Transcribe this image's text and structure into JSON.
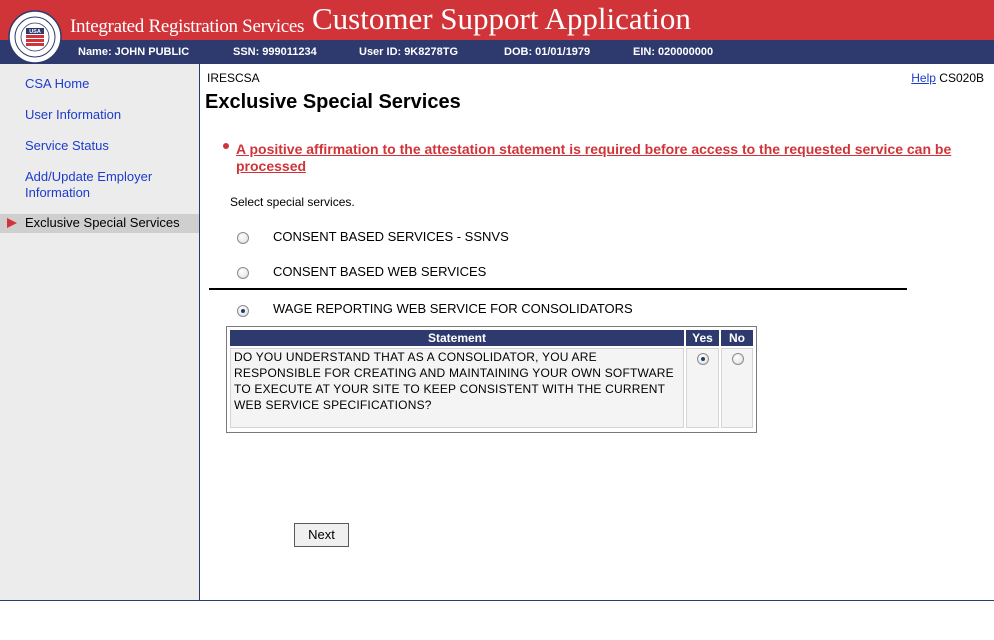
{
  "header": {
    "subtitle": "Integrated Registration Services",
    "title": "Customer Support Application",
    "seal_text": "USA"
  },
  "user_info": {
    "name_label": "Name:",
    "name": "JOHN PUBLIC",
    "ssn_label": "SSN:",
    "ssn": "999011234",
    "userid_label": "User ID:",
    "userid": "9K8278TG",
    "dob_label": "DOB:",
    "dob": "01/01/1979",
    "ein_label": "EIN:",
    "ein": "020000000"
  },
  "sidebar": {
    "items": [
      {
        "label": "CSA Home"
      },
      {
        "label": "User Information"
      },
      {
        "label": "Service Status"
      },
      {
        "label": "Add/Update Employer Information"
      }
    ],
    "active": "Exclusive Special Services"
  },
  "main": {
    "screen_code": "IRESCSA",
    "help_label": "Help",
    "screen_id": "CS020B",
    "title": "Exclusive Special Services",
    "error": "A positive affirmation to the attestation statement is required before access to the requested service can be processed",
    "instruction": "Select special services.",
    "services": [
      {
        "label": "CONSENT BASED SERVICES - SSNVS",
        "selected": false
      },
      {
        "label": "CONSENT BASED WEB SERVICES",
        "selected": false
      },
      {
        "label": "WAGE REPORTING WEB SERVICE FOR CONSOLIDATORS",
        "selected": true
      }
    ],
    "statement_table": {
      "headers": [
        "Statement",
        "Yes",
        "No"
      ],
      "text": "DO YOU UNDERSTAND THAT AS A CONSOLIDATOR, YOU ARE RESPONSIBLE FOR CREATING AND MAINTAINING YOUR OWN SOFTWARE TO EXECUTE AT YOUR SITE TO KEEP CONSISTENT WITH THE CURRENT WEB SERVICE SPECIFICATIONS?",
      "answer": "Yes"
    },
    "next_label": "Next"
  },
  "colors": {
    "header_red": "#d13438",
    "navy": "#2e3a6e",
    "link_blue": "#1d3ccb",
    "error_red": "#d13438"
  }
}
